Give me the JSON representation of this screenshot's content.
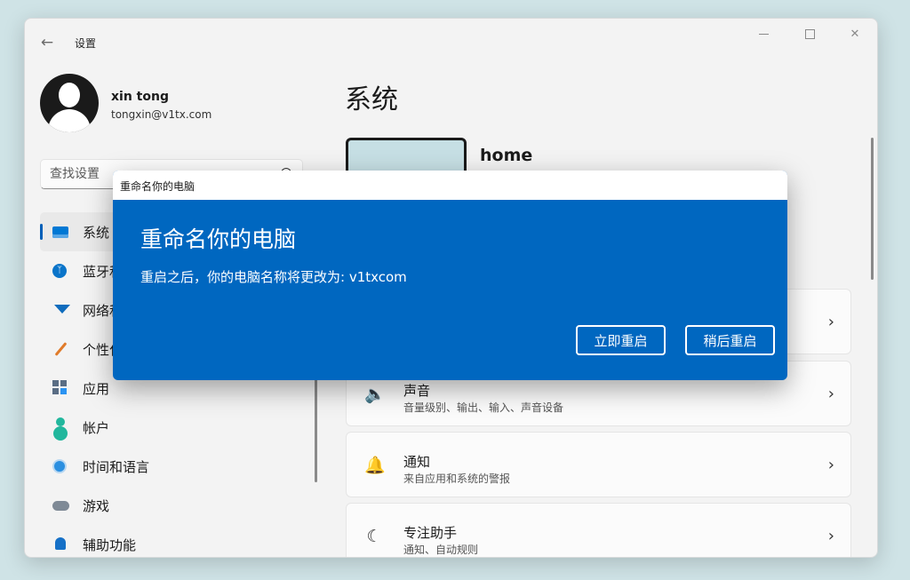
{
  "window": {
    "title": "设置"
  },
  "user": {
    "name": "xin tong",
    "email": "tongxin@v1tx.com"
  },
  "search": {
    "placeholder": "查找设置"
  },
  "sidebar": {
    "items": [
      {
        "label": "系统",
        "icon": "system-icon",
        "selected": true
      },
      {
        "label": "蓝牙和其他设备",
        "icon": "bluetooth-icon"
      },
      {
        "label": "网络和 Internet",
        "icon": "wifi-icon"
      },
      {
        "label": "个性化",
        "icon": "brush-icon"
      },
      {
        "label": "应用",
        "icon": "apps-icon"
      },
      {
        "label": "帐户",
        "icon": "account-icon"
      },
      {
        "label": "时间和语言",
        "icon": "time-language-icon"
      },
      {
        "label": "游戏",
        "icon": "gamepad-icon"
      },
      {
        "label": "辅助功能",
        "icon": "accessibility-icon"
      }
    ]
  },
  "main": {
    "title": "系统",
    "device_name": "home",
    "cards": [
      {
        "title": "声音",
        "subtitle": "音量级别、输出、输入、声音设备",
        "icon": "speaker-icon"
      },
      {
        "title": "通知",
        "subtitle": "来自应用和系统的警报",
        "icon": "bell-icon"
      },
      {
        "title": "专注助手",
        "subtitle": "通知、自动规则",
        "icon": "moon-icon"
      }
    ]
  },
  "dialog": {
    "window_title": "重命名你的电脑",
    "heading": "重命名你的电脑",
    "message": "重启之后，你的电脑名称将更改为: v1txcom",
    "restart_now_label": "立即重启",
    "restart_later_label": "稍后重启"
  },
  "colors": {
    "accent": "#0067c0",
    "selected_indicator": "#005fb8",
    "background": "#cfe3e6"
  }
}
